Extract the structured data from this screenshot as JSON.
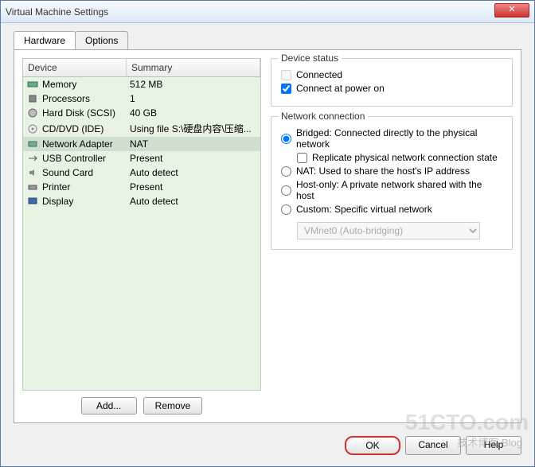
{
  "window": {
    "title": "Virtual Machine Settings"
  },
  "tabs": {
    "hardware": "Hardware",
    "options": "Options"
  },
  "table": {
    "head_device": "Device",
    "head_summary": "Summary",
    "rows": [
      {
        "device": "Memory",
        "summary": "512 MB"
      },
      {
        "device": "Processors",
        "summary": "1"
      },
      {
        "device": "Hard Disk (SCSI)",
        "summary": "40 GB"
      },
      {
        "device": "CD/DVD (IDE)",
        "summary": "Using file S:\\硬盘内容\\压缩..."
      },
      {
        "device": "Network Adapter",
        "summary": "NAT"
      },
      {
        "device": "USB Controller",
        "summary": "Present"
      },
      {
        "device": "Sound Card",
        "summary": "Auto detect"
      },
      {
        "device": "Printer",
        "summary": "Present"
      },
      {
        "device": "Display",
        "summary": "Auto detect"
      }
    ]
  },
  "left_buttons": {
    "add": "Add...",
    "remove": "Remove"
  },
  "device_status": {
    "legend": "Device status",
    "connected": "Connected",
    "connect_power": "Connect at power on"
  },
  "network": {
    "legend": "Network connection",
    "bridged": "Bridged: Connected directly to the physical network",
    "replicate": "Replicate physical network connection state",
    "nat": "NAT: Used to share the host's IP address",
    "hostonly": "Host-only: A private network shared with the host",
    "custom": "Custom: Specific virtual network",
    "combo": "VMnet0 (Auto-bridging)"
  },
  "footer": {
    "ok": "OK",
    "cancel": "Cancel",
    "help": "Help"
  },
  "watermark": {
    "main": "51CTO.com",
    "sub": "技术博客  Blog"
  }
}
